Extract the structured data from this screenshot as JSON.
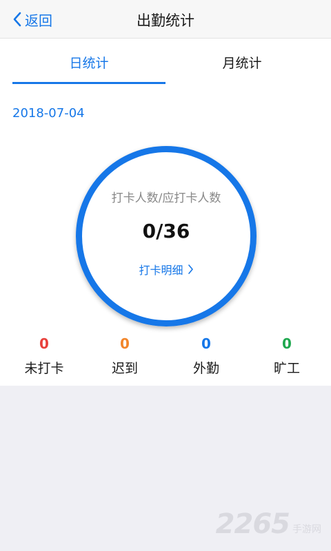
{
  "header": {
    "back_label": "返回",
    "title": "出勤统计"
  },
  "tabs": [
    {
      "label": "日统计",
      "active": true
    },
    {
      "label": "月统计",
      "active": false
    }
  ],
  "date": "2018-07-04",
  "summary": {
    "caption": "打卡人数/应打卡人数",
    "count": "0/36",
    "detail_link": "打卡明细"
  },
  "stats": [
    {
      "value": "0",
      "label": "未打卡",
      "color": "#e8413c"
    },
    {
      "value": "0",
      "label": "迟到",
      "color": "#f2862b"
    },
    {
      "value": "0",
      "label": "外勤",
      "color": "#1677e8"
    },
    {
      "value": "0",
      "label": "旷工",
      "color": "#1fa84f"
    }
  ],
  "watermark": {
    "digits": "2265",
    "text": "手游网"
  },
  "colors": {
    "accent": "#1677e8",
    "nav_bg": "#f7f7f7",
    "empty_bg": "#efeff4"
  },
  "icons": {
    "back": "chevron-left-icon",
    "detail": "chevron-right-icon"
  }
}
